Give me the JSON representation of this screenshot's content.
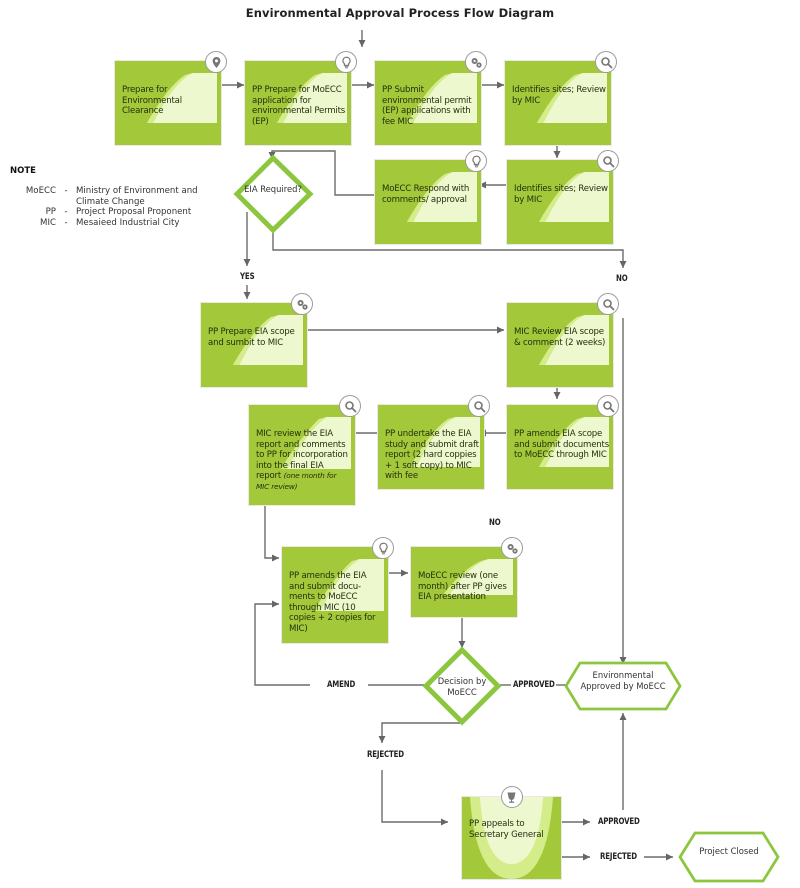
{
  "title": "Environmental Approval Process Flow Diagram",
  "note": {
    "heading": "NOTE",
    "entries": [
      {
        "abbr": "MoECC",
        "sep": "-",
        "meaning": "Ministry of Environment and Climate Change"
      },
      {
        "abbr": "PP",
        "sep": "-",
        "meaning": "Project Proposal Proponent"
      },
      {
        "abbr": "MIC",
        "sep": "-",
        "meaning": "Mesaieed Industrial City"
      }
    ]
  },
  "steps": {
    "s1": {
      "text": "Prepare for Environmental Clearance",
      "icon": "map-pin-icon"
    },
    "s2": {
      "text": "PP Prepare for MoECC application for environmental Permits (EP)",
      "icon": "lightbulb-icon"
    },
    "s3": {
      "text": "PP Submit environmental permit (EP) applications with fee MIC",
      "icon": "gears-icon"
    },
    "s4": {
      "text": "Identifies sites; Review by MIC",
      "icon": "search-icon"
    },
    "s5": {
      "text": "Identifies sites; Review by MIC",
      "icon": "search-icon"
    },
    "s6": {
      "text": "MoECC Respond with comments/ approval",
      "icon": "lightbulb-icon"
    },
    "s7": {
      "text": "PP Prepare EIA scope and sumbit to MIC",
      "icon": "gears-icon"
    },
    "s8": {
      "text": "MIC Review EIA scope & comment (2 weeks)",
      "icon": "search-icon"
    },
    "s9": {
      "text": "PP amends EIA scope and submit documents to MoECC through MIC",
      "icon": "search-icon"
    },
    "s10": {
      "text": "PP undertake the EIA study and submit draft report (2 hard coppies + 1 soft copy) to MIC with fee",
      "icon": "search-icon"
    },
    "s11": {
      "text": "MIC review the EIA report and comments to PP for incorporation into the final EIA report",
      "note": "(one month for MIC review)",
      "icon": "search-icon"
    },
    "s12": {
      "text": "PP amends the EIA and submit docu-ments to MoECC through MIC (10 copies + 2 copies for MIC)",
      "icon": "lightbulb-icon"
    },
    "s13": {
      "text": "MoECC review (one month) after PP gives EIA presentation",
      "icon": "gears-icon"
    },
    "s14": {
      "text": "PP appeals to Secretary General",
      "icon": "trophy-icon"
    }
  },
  "decisions": {
    "d1": {
      "text": "EIA Required?"
    },
    "d2": {
      "text": "Decision by MoECC"
    }
  },
  "terminals": {
    "t1": {
      "text": "Environmental Approved by MoECC"
    },
    "t2": {
      "text": "Project Closed"
    }
  },
  "labels": {
    "yes": "YES",
    "no_top": "NO",
    "no_mid": "NO",
    "amend": "AMEND",
    "approved_decision": "APPROVED",
    "rejected_decision": "REJECTED",
    "approved_appeal": "APPROVED",
    "rejected_appeal": "REJECTED"
  },
  "colors": {
    "box_green": "#a3c93a",
    "box_light": "#e6f5b8",
    "outline_green": "#8cc63f",
    "line_gray": "#666666"
  }
}
